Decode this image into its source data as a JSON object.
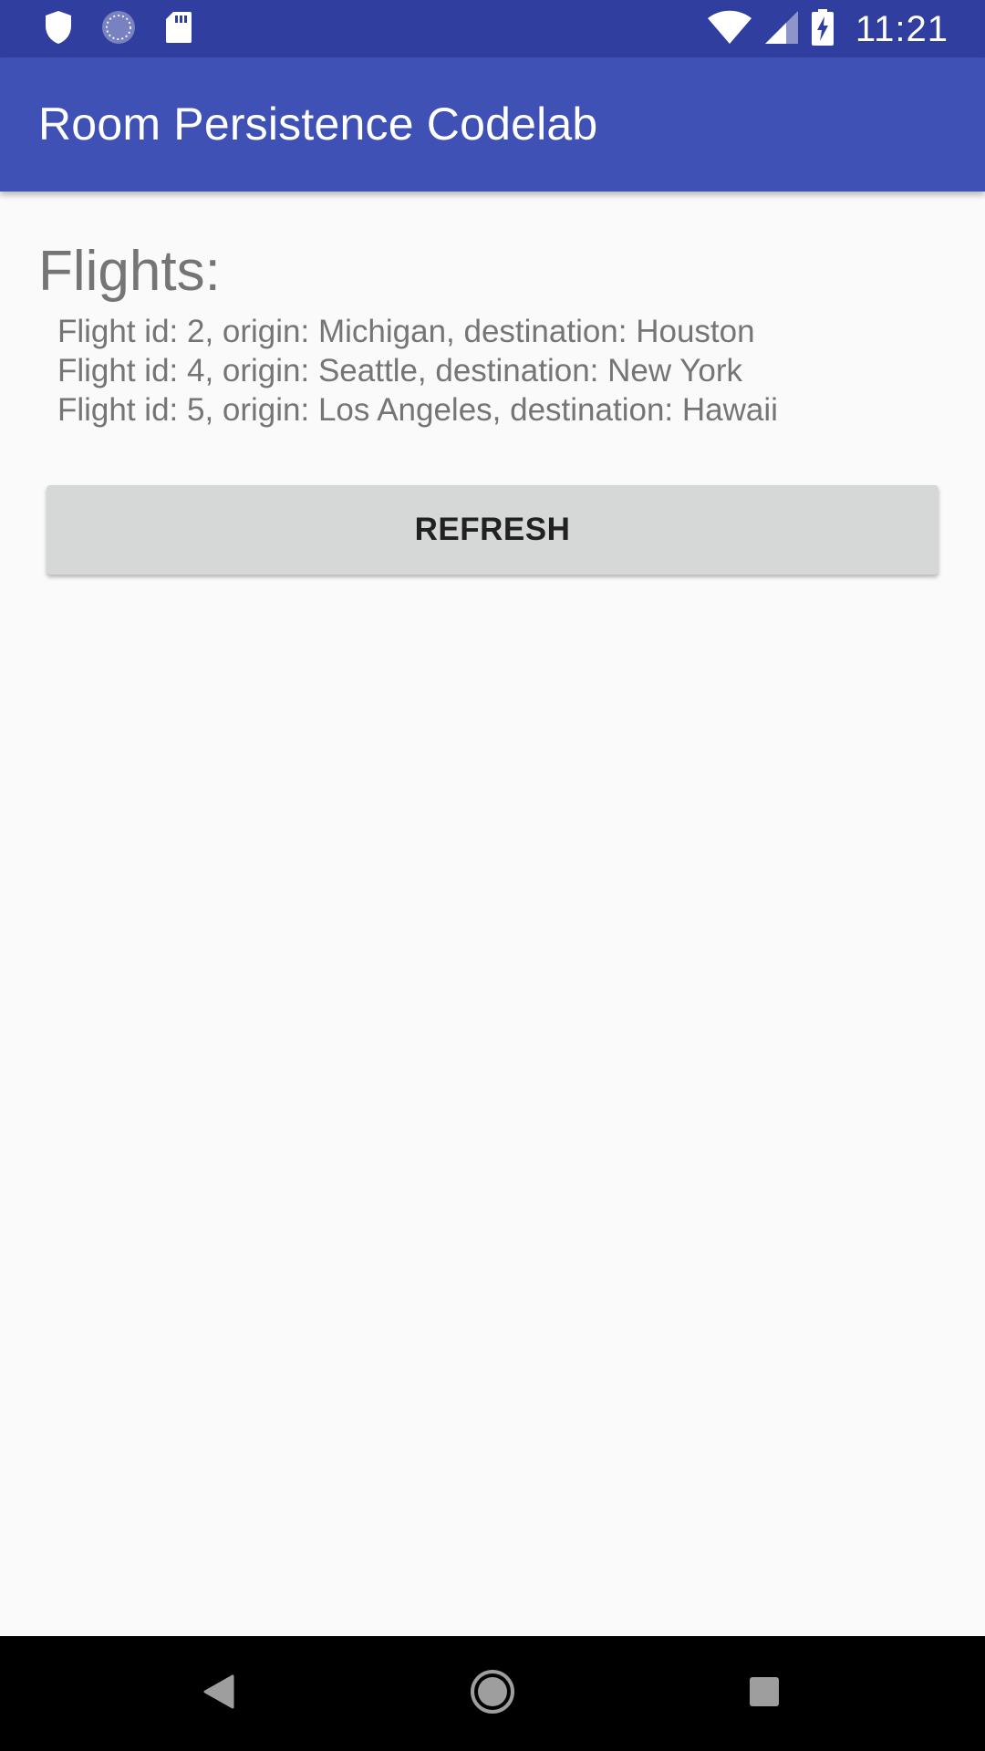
{
  "status_bar": {
    "time": "11:21",
    "icons": [
      "shield-icon",
      "loading-icon",
      "sd-card-icon",
      "wifi-icon",
      "signal-icon",
      "battery-charging-icon"
    ]
  },
  "app_bar": {
    "title": "Room Persistence Codelab"
  },
  "main": {
    "heading": "Flights:",
    "flights": [
      "Flight id: 2, origin: Michigan, destination: Houston",
      "Flight id: 4, origin: Seattle, destination: New York",
      "Flight id: 5, origin: Los Angeles, destination: Hawaii"
    ],
    "refresh_label": "REFRESH"
  },
  "nav_bar": {
    "icons": [
      "back-icon",
      "home-icon",
      "recents-icon"
    ]
  },
  "colors": {
    "status_bar": "#303f9f",
    "app_bar": "#3f51b5",
    "background": "#fafafa",
    "button": "#d6d7d7",
    "secondary_text": "#757575"
  }
}
